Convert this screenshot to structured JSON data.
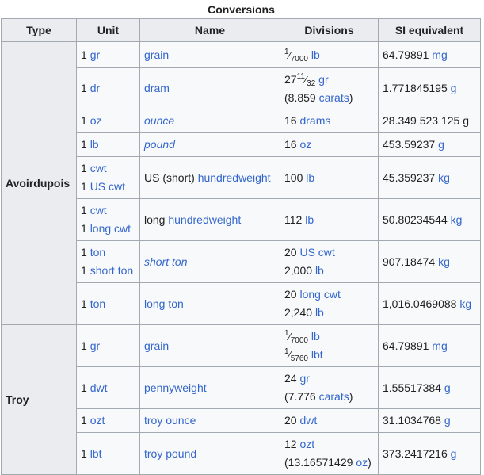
{
  "caption": "Conversions",
  "headers": [
    "Type",
    "Unit",
    "Name",
    "Divisions",
    "SI equivalent"
  ],
  "groups": [
    {
      "type": "Avoirdupois",
      "rows": [
        {
          "unit": [
            {
              "n": "1 ",
              "a": "gr"
            }
          ],
          "name": {
            "pre": "",
            "a": "grain",
            "italic": false
          },
          "div": [
            {
              "kind": "frac",
              "num": "1",
              "den": "7000",
              "a": "lb"
            }
          ],
          "si": {
            "val": "64.79891 ",
            "a": "mg"
          }
        },
        {
          "unit": [
            {
              "n": "1 ",
              "a": "dr"
            }
          ],
          "name": {
            "pre": "",
            "a": "dram",
            "italic": false
          },
          "div": [
            {
              "kind": "mixed",
              "whole": "27",
              "num": "11",
              "den": "32",
              "a": "gr"
            },
            {
              "kind": "text",
              "pre": "(8.859 ",
              "a": "carats",
              "post": ")"
            }
          ],
          "si": {
            "val": "1.771845195 ",
            "a": "g"
          }
        },
        {
          "unit": [
            {
              "n": "1 ",
              "a": "oz"
            }
          ],
          "name": {
            "pre": "",
            "a": "ounce",
            "italic": true
          },
          "div": [
            {
              "kind": "text",
              "pre": "16 ",
              "a": "drams",
              "post": ""
            }
          ],
          "si": {
            "val": "28.349 523 125 g",
            "a": ""
          }
        },
        {
          "unit": [
            {
              "n": "1 ",
              "a": "lb"
            }
          ],
          "name": {
            "pre": "",
            "a": "pound",
            "italic": true
          },
          "div": [
            {
              "kind": "text",
              "pre": "16 ",
              "a": "oz",
              "post": ""
            }
          ],
          "si": {
            "val": "453.59237 ",
            "a": "g"
          }
        },
        {
          "unit": [
            {
              "n": "1 ",
              "a": "cwt"
            },
            {
              "n": "1 ",
              "a": "US cwt"
            }
          ],
          "name": {
            "pre": "US (short) ",
            "a": "hundredweight",
            "italic": false
          },
          "div": [
            {
              "kind": "text",
              "pre": "100 ",
              "a": "lb",
              "post": ""
            }
          ],
          "si": {
            "val": "45.359237 ",
            "a": "kg"
          }
        },
        {
          "unit": [
            {
              "n": "1 ",
              "a": "cwt"
            },
            {
              "n": "1 ",
              "a": "long cwt"
            }
          ],
          "name": {
            "pre": "long ",
            "a": "hundredweight",
            "italic": false
          },
          "div": [
            {
              "kind": "text",
              "pre": "112 ",
              "a": "lb",
              "post": ""
            }
          ],
          "si": {
            "val": "50.80234544 ",
            "a": "kg"
          }
        },
        {
          "unit": [
            {
              "n": "1 ",
              "a": "ton"
            },
            {
              "n": "1 ",
              "a": "short ton"
            }
          ],
          "name": {
            "pre": "",
            "a": "short ton",
            "italic": true
          },
          "div": [
            {
              "kind": "text",
              "pre": "20 ",
              "a": "US cwt",
              "post": ""
            },
            {
              "kind": "text",
              "pre": "2,000 ",
              "a": "lb",
              "post": ""
            }
          ],
          "si": {
            "val": "907.18474 ",
            "a": "kg"
          }
        },
        {
          "unit": [
            {
              "n": "1 ",
              "a": "ton"
            }
          ],
          "name": {
            "pre": "",
            "a": "long ton",
            "italic": false
          },
          "div": [
            {
              "kind": "text",
              "pre": "20 ",
              "a": "long cwt",
              "post": ""
            },
            {
              "kind": "text",
              "pre": "2,240 ",
              "a": "lb",
              "post": ""
            }
          ],
          "si": {
            "val": "1,016.0469088 ",
            "a": "kg"
          }
        }
      ]
    },
    {
      "type": "Troy",
      "rows": [
        {
          "unit": [
            {
              "n": "1 ",
              "a": "gr"
            }
          ],
          "name": {
            "pre": "",
            "a": "grain",
            "italic": false
          },
          "div": [
            {
              "kind": "frac",
              "num": "1",
              "den": "7000",
              "a": "lb"
            },
            {
              "kind": "frac",
              "num": "1",
              "den": "5760",
              "a": "lbt"
            }
          ],
          "si": {
            "val": "64.79891 ",
            "a": "mg"
          }
        },
        {
          "unit": [
            {
              "n": "1 ",
              "a": "dwt"
            }
          ],
          "name": {
            "pre": "",
            "a": "pennyweight",
            "italic": false
          },
          "div": [
            {
              "kind": "text",
              "pre": "24 ",
              "a": "gr",
              "post": ""
            },
            {
              "kind": "text",
              "pre": "(7.776 ",
              "a": "carats",
              "post": ")"
            }
          ],
          "si": {
            "val": "1.55517384 ",
            "a": "g"
          }
        },
        {
          "unit": [
            {
              "n": "1 ",
              "a": "ozt"
            }
          ],
          "name": {
            "pre": "",
            "a": "troy ounce",
            "italic": false
          },
          "div": [
            {
              "kind": "text",
              "pre": "20 ",
              "a": "dwt",
              "post": ""
            }
          ],
          "si": {
            "val": "31.1034768 ",
            "a": "g"
          }
        },
        {
          "unit": [
            {
              "n": "1 ",
              "a": "lbt"
            }
          ],
          "name": {
            "pre": "",
            "a": "troy pound",
            "italic": false
          },
          "div": [
            {
              "kind": "text",
              "pre": "12 ",
              "a": "ozt",
              "post": ""
            },
            {
              "kind": "text",
              "pre": "(13.16571429 ",
              "a": "oz",
              "post": ")"
            }
          ],
          "si": {
            "val": "373.2417216 ",
            "a": "g"
          }
        }
      ]
    }
  ]
}
